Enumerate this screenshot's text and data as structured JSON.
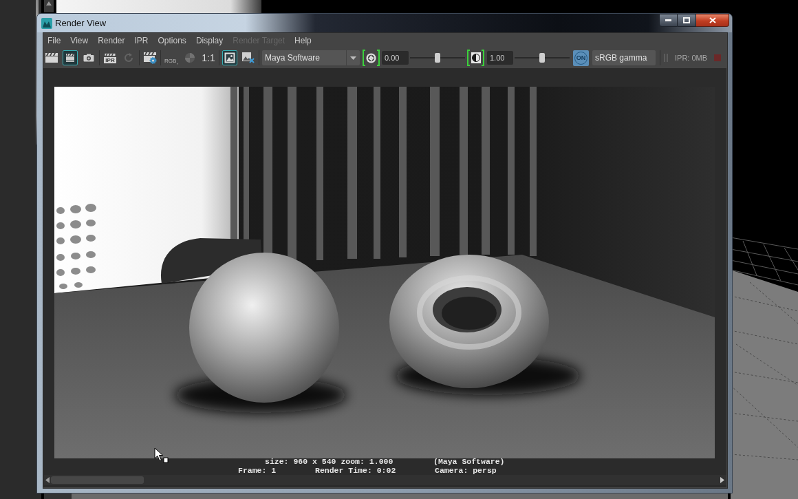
{
  "window": {
    "title": "Render View"
  },
  "menu": [
    {
      "label": "File",
      "disabled": false
    },
    {
      "label": "View",
      "disabled": false
    },
    {
      "label": "Render",
      "disabled": false
    },
    {
      "label": "IPR",
      "disabled": false
    },
    {
      "label": "Options",
      "disabled": false
    },
    {
      "label": "Display",
      "disabled": false
    },
    {
      "label": "Render Target",
      "disabled": true
    },
    {
      "label": "Help",
      "disabled": false
    }
  ],
  "toolbar": {
    "groups": [
      {
        "tools": [
          {
            "kind": "render",
            "on": false,
            "disabled": false
          },
          {
            "kind": "region",
            "on": true,
            "disabled": false
          },
          {
            "kind": "snapshot",
            "on": false,
            "disabled": false
          }
        ]
      },
      {
        "tools": [
          {
            "kind": "ipr",
            "label": "IPR",
            "on": false,
            "disabled": false
          },
          {
            "kind": "refresh",
            "on": false,
            "disabled": true
          }
        ]
      },
      {
        "tools": [
          {
            "kind": "settings",
            "on": false,
            "disabled": false
          }
        ]
      },
      {
        "tools": [
          {
            "kind": "rgb",
            "label": "RGB",
            "on": false,
            "disabled": false
          },
          {
            "kind": "checker",
            "on": false,
            "disabled": true
          },
          {
            "kind": "ratio",
            "label": "1:1",
            "on": false,
            "disabled": false
          }
        ]
      },
      {
        "tools": [
          {
            "kind": "keep",
            "on": true,
            "disabled": false
          },
          {
            "kind": "remove",
            "on": false,
            "disabled": false
          }
        ]
      }
    ]
  },
  "renderer": {
    "value": "Maya Software"
  },
  "exposure": {
    "on": true,
    "value": "0.00",
    "level": 0.5
  },
  "gamma": {
    "on": true,
    "value": "1.00",
    "level": 0.5
  },
  "view_transform": {
    "on": true,
    "badge": "ON",
    "value": "sRGB gamma"
  },
  "ipr": {
    "memory": "IPR: 0MB"
  },
  "status": {
    "size": "size: 960 x 540 zoom: 1.000",
    "renderer": "(Maya Software)",
    "frame": "Frame: 1",
    "render_time": "Render Time: 0:02",
    "camera": "Camera: persp"
  }
}
